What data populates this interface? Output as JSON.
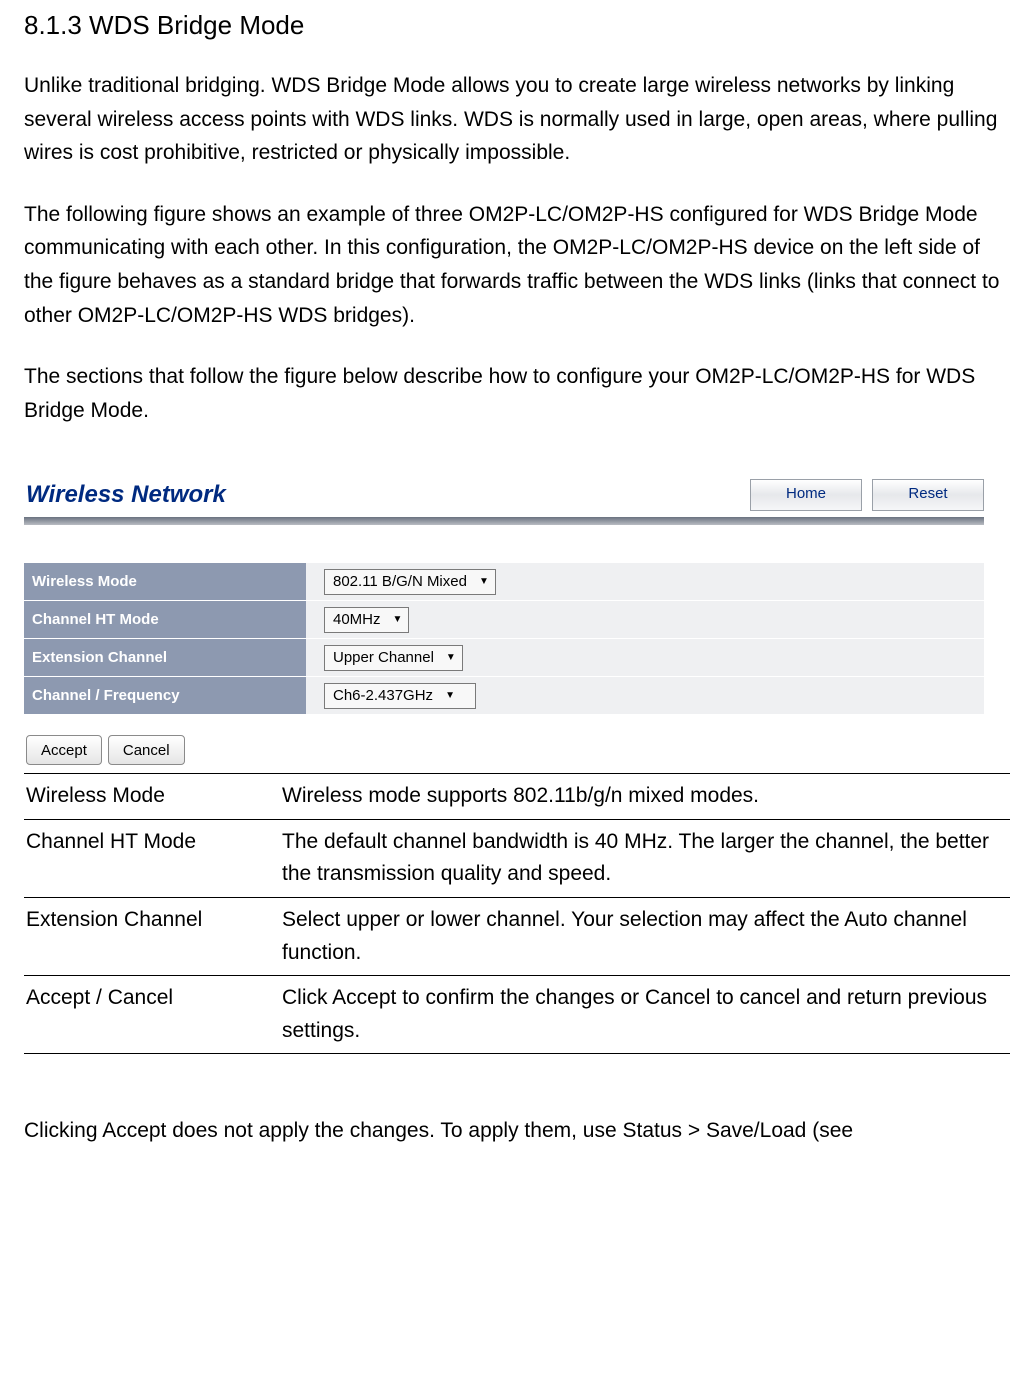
{
  "section_heading": "8.1.3 WDS Bridge Mode",
  "para1": "Unlike traditional bridging. WDS Bridge Mode allows you to create large wireless networks by linking several wireless access points with WDS links. WDS is normally used in large, open areas, where pulling wires is cost prohibitive, restricted or physically impossible.",
  "para2": "The following figure shows an example of three OM2P-LC/OM2P-HS configured for WDS Bridge Mode communicating with each other. In this configuration, the OM2P-LC/OM2P-HS device on the left side of the figure behaves as a standard bridge that forwards traffic between the WDS links (links that connect to other OM2P-LC/OM2P-HS WDS bridges).",
  "para3": "The sections that follow the figure below describe how to configure your OM2P-LC/OM2P-HS for WDS Bridge Mode.",
  "panel": {
    "title": "Wireless Network",
    "buttons": {
      "home": "Home",
      "reset": "Reset"
    },
    "rows": {
      "wireless_mode": {
        "label": "Wireless Mode",
        "value": "802.11 B/G/N Mixed"
      },
      "channel_ht": {
        "label": "Channel HT Mode",
        "value": "40MHz"
      },
      "extension": {
        "label": "Extension Channel",
        "value": "Upper Channel"
      },
      "freq": {
        "label": "Channel / Frequency",
        "value": "Ch6-2.437GHz"
      }
    },
    "actions": {
      "accept": "Accept",
      "cancel": "Cancel"
    }
  },
  "desc": {
    "r1": {
      "k": "Wireless Mode",
      "v": "Wireless mode supports 802.11b/g/n mixed modes."
    },
    "r2": {
      "k": "Channel HT Mode",
      "v": "The default channel bandwidth is 40 MHz. The larger the channel, the better the transmission quality and speed."
    },
    "r3": {
      "k": "Extension Channel",
      "v": "Select upper or lower channel. Your selection may affect the Auto channel function."
    },
    "r4": {
      "k": "Accept / Cancel",
      "v": "Click Accept to confirm the changes or Cancel to cancel and return previous settings."
    }
  },
  "footnote": "Clicking Accept does not apply the changes. To apply them, use Status > Save/Load (see"
}
